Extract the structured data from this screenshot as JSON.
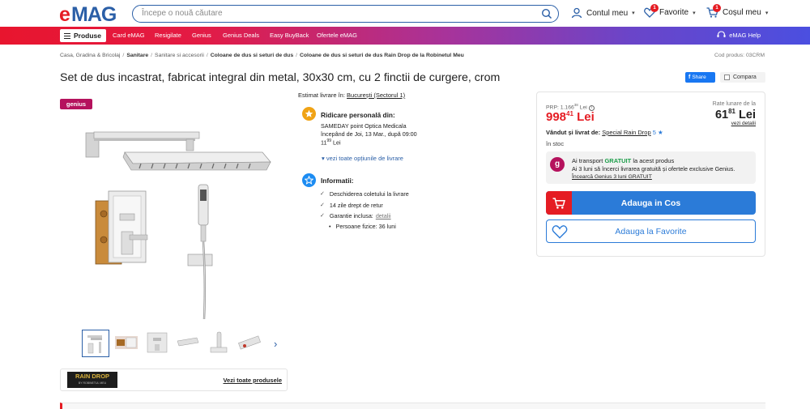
{
  "header": {
    "logo_text": "eMAG",
    "search_placeholder": "Începe o nouă căutare",
    "account_label": "Contul meu",
    "favorites_label": "Favorite",
    "favorites_count": "1",
    "cart_label": "Coșul meu",
    "cart_count": "1"
  },
  "nav": {
    "produse_label": "Produse",
    "links": [
      "Card eMAG",
      "Resigilate",
      "Genius",
      "Genius Deals",
      "Easy BuyBack",
      "Ofertele eMAG"
    ],
    "help_label": "eMAG Help"
  },
  "breadcrumb": {
    "items": [
      "Casa, Gradina & Bricolaj",
      "Sanitare",
      "Sanitare si accesorii",
      "Coloane de dus si seturi de dus",
      "Coloane de dus si seturi de dus Rain Drop de la Robinetul Meu"
    ],
    "product_code": "Cod produs: 03CRM"
  },
  "product": {
    "title": "Set de dus incastrat, fabricat integral din metal, 30x30 cm, cu 2 finctii de curgere, crom",
    "share_label": "Share",
    "compare_label": "Compara",
    "genius_badge": "genius"
  },
  "brand": {
    "logo_text": "RAIN DROP",
    "logo_sub": "BY ROBINETUL MEU",
    "see_all_label": "Vezi toate produsele"
  },
  "delivery": {
    "estimate_label": "Estimat livrare în:",
    "estimate_location": "București (Sectorul 1)",
    "pickup_title": "Ridicare personală din:",
    "pickup_point": "SAMEDAY point Optica Medicala",
    "pickup_date": "începând de Joi, 13 Mar., după 09:00",
    "pickup_price_int": "11",
    "pickup_price_dec": "99",
    "pickup_currency": "Lei",
    "more_options": "vezi toate opțiunile de livrare",
    "info_title": "Informatii:",
    "info_items": [
      "Deschiderea coletului la livrare",
      "14 zile drept de retur",
      "Garantie inclusa:"
    ],
    "warranty_details_link": "detalii",
    "warranty_sub": "Persoane fizice: 36 luni"
  },
  "buybox": {
    "prp_label": "PRP: 1.166",
    "prp_dec": "38",
    "prp_currency": "Lei",
    "price_int": "998",
    "price_dec": "41",
    "price_currency": "Lei",
    "rate_label": "Rate lunare de la",
    "rate_int": "61",
    "rate_dec": "81",
    "rate_currency": "Lei",
    "rate_details": "vezi detalii",
    "sold_label": "Vândut și livrat de:",
    "seller": "Special Rain Drop",
    "seller_rating": "5",
    "stock": "în stoc",
    "genius_line1_pre": "Ai transport",
    "genius_line1_free": "GRATUIT",
    "genius_line1_post": "la acest produs",
    "genius_line2": "Ai 3 luni să încerci livrarea gratuită și ofertele exclusive Genius.",
    "genius_line3": "Încearcă Genius 3 luni GRATUIT",
    "add_to_cart": "Adauga in Cos",
    "add_to_fav": "Adauga la Favorite"
  },
  "colors": {
    "brand_red": "#e51c23",
    "brand_blue": "#2b7bd8",
    "genius_magenta": "#b5125d"
  }
}
